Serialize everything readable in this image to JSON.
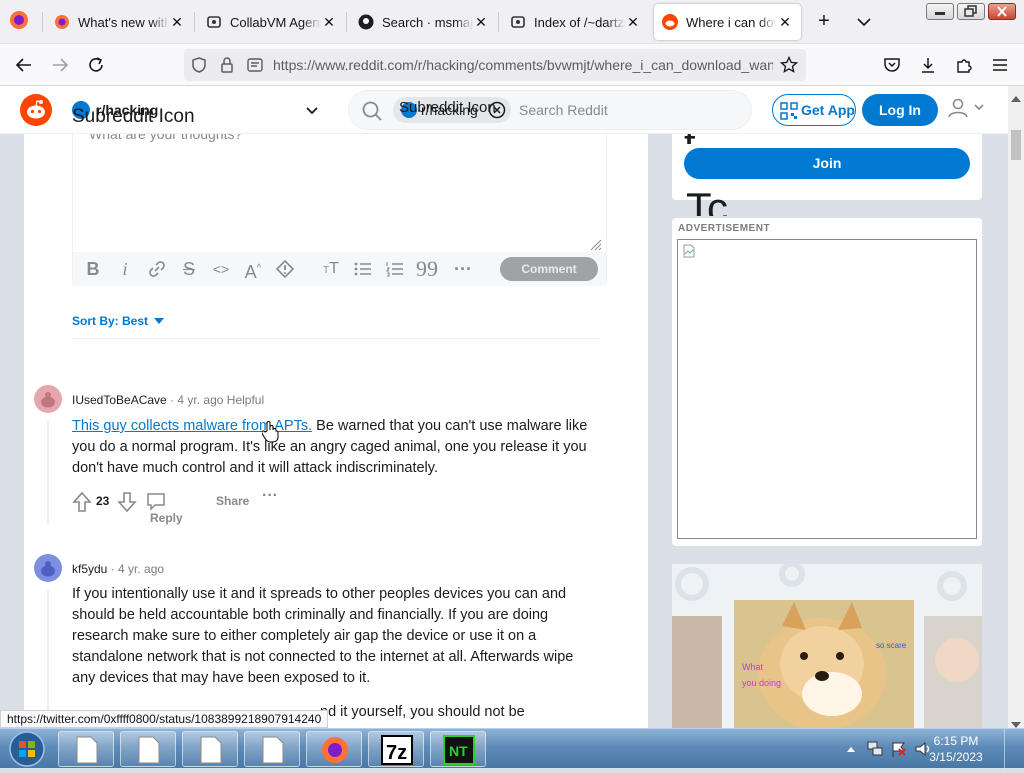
{
  "browser": {
    "tabs": [
      {
        "title": "What's new with Firefox",
        "favicon": "firefox-icon",
        "active": false
      },
      {
        "title": "CollabVM Agent - CollabVM",
        "favicon": "collabvm-icon",
        "active": false
      },
      {
        "title": "Search · msmajor",
        "favicon": "github-icon",
        "active": false
      },
      {
        "title": "Index of /~dartz/isos",
        "favicon": "collabvm-icon",
        "active": false
      },
      {
        "title": "Where i can download",
        "favicon": "reddit-icon",
        "active": true
      }
    ],
    "url": "https://www.reddit.com/r/hacking/comments/bvwmjt/where_i_can_download_wan"
  },
  "reddit_header": {
    "subreddit_icon_alt": "Subreddit Icon",
    "subreddit": "r/hacking",
    "search_chip_alt": "Subreddit Icon",
    "search_chip_label": "r/hacking",
    "search_placeholder": "Search Reddit",
    "get_app": "Get App",
    "login": "Log In"
  },
  "editor": {
    "placeholder": "What are your thoughts?",
    "comment_button": "Comment"
  },
  "sort": {
    "label": "Sort By: Best"
  },
  "comments": [
    {
      "author": "IUsedToBeACave",
      "age": "4 yr. ago",
      "award": "Helpful",
      "link_text": "This guy collects malware from APTs.",
      "body": " Be warned that you can't use malware like you do a normal program. It's like an angry caged animal, one you release it you don't have much control and it will attack indiscriminately.",
      "votes": "23",
      "reply": "Reply",
      "share": "Share",
      "avatar_color": "#e8a5ad"
    },
    {
      "author": "kf5ydu",
      "age": "4 yr. ago",
      "body": "If you intentionally use it and it spreads to other peoples devices you can and should be held accountable both criminally and financially. If you are doing research make sure to either completely air gap the device or use it on a standalone network that is not connected to the internet at all. Afterwards wipe any devices that may have been exposed to it.",
      "cut_line": "nd it yourself, you should not be",
      "avatar_color": "#7e8ee0"
    }
  ],
  "sidebar": {
    "join": "Join",
    "big_letter_top": "t",
    "big_letters": "Tc",
    "ad_label": "ADVERTISEMENT",
    "promo_text": [
      "What",
      "you doing",
      "so scare"
    ]
  },
  "status_url": "https://twitter.com/0xffff0800/status/1083899218907914240",
  "taskbar": {
    "time": "6:15 PM",
    "date": "3/15/2023"
  }
}
